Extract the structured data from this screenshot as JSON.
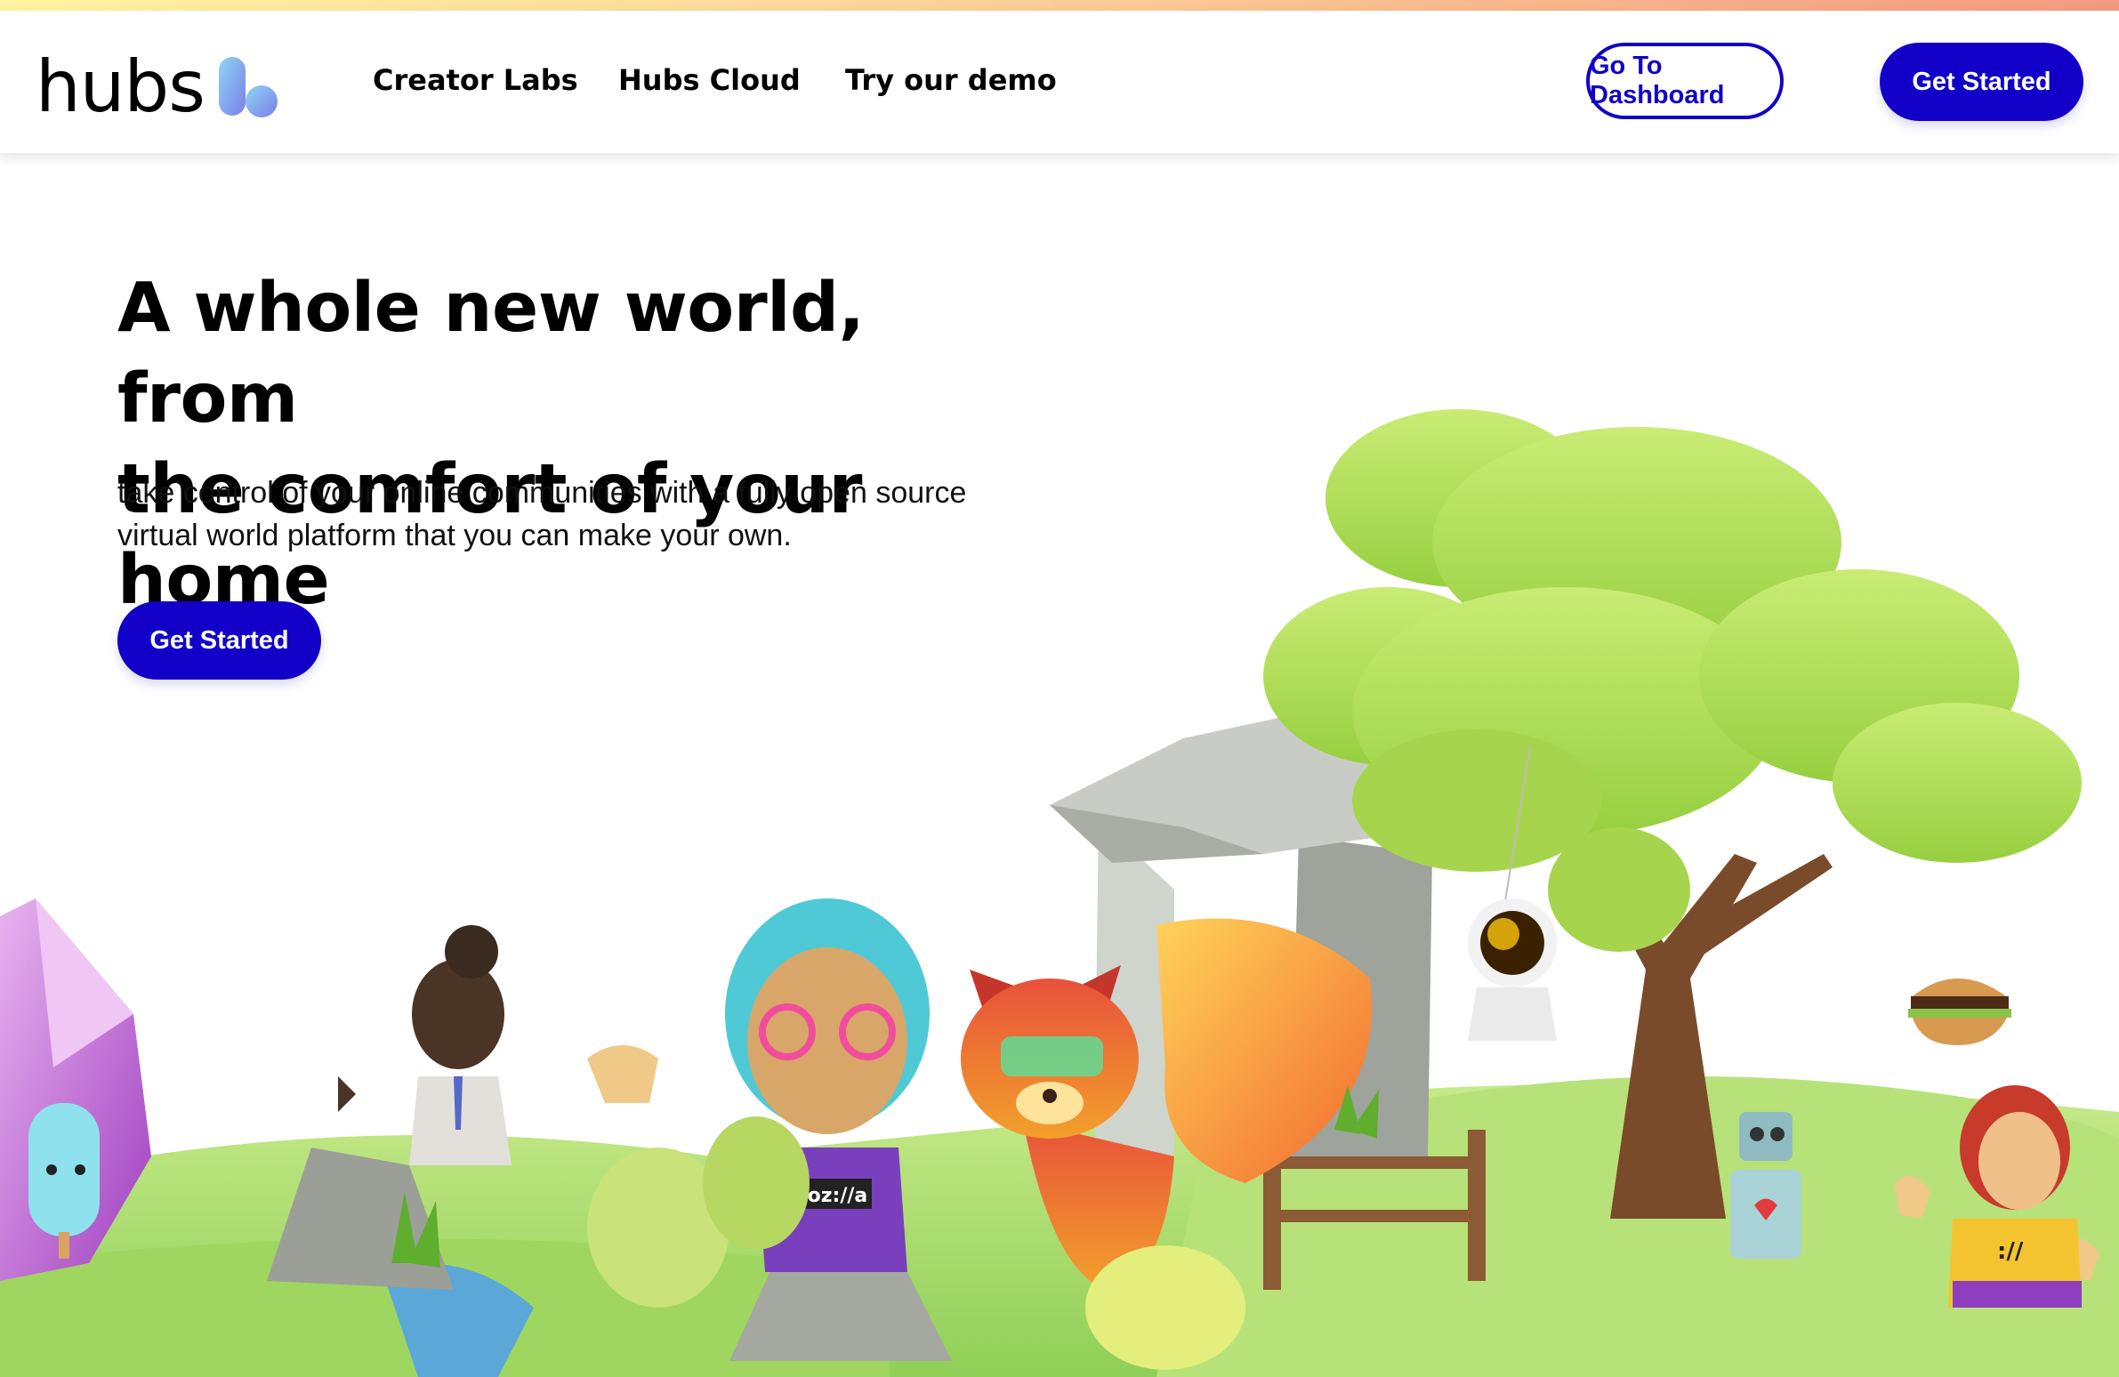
{
  "brand": {
    "name": "hubs",
    "accent": "#1200c8"
  },
  "nav": {
    "links": [
      "Creator Labs",
      "Hubs Cloud",
      "Try our demo"
    ],
    "dashboard_label": "Go To Dashboard",
    "get_started_label": "Get Started"
  },
  "hero": {
    "title_line1": "A whole new world, from",
    "title_line2": "the comfort of your home",
    "subtitle_line1": "take control of your online communities with a fully open source",
    "subtitle_line2": "virtual world platform that you can make your own.",
    "cta_label": "Get Started"
  },
  "illustration": {
    "shirt_text": "moz://a",
    "badge_text": "://",
    "icons": [
      "tree",
      "dolmen",
      "avatar",
      "red-panda",
      "astronaut",
      "robot",
      "burger",
      "popsicle",
      "crystal",
      "fence"
    ]
  }
}
